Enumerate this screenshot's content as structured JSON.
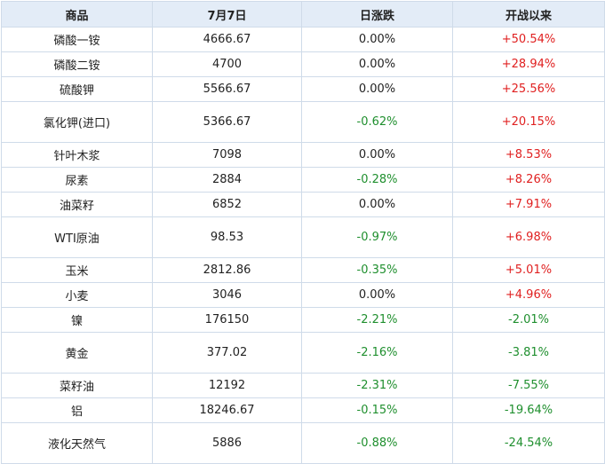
{
  "headers": [
    "商品",
    "7月7日",
    "日涨跌",
    "开战以来"
  ],
  "rows": [
    {
      "name": "磷酸一铵",
      "price": "4666.67",
      "daily": "0.00%",
      "since": "+50.54%"
    },
    {
      "name": "磷酸二铵",
      "price": "4700",
      "daily": "0.00%",
      "since": "+28.94%"
    },
    {
      "name": "硫酸钾",
      "price": "5566.67",
      "daily": "0.00%",
      "since": "+25.56%"
    },
    {
      "name": "氯化钾(进口)",
      "price": "5366.67",
      "daily": "-0.62%",
      "since": "+20.15%"
    },
    {
      "name": "针叶木浆",
      "price": "7098",
      "daily": "0.00%",
      "since": "+8.53%"
    },
    {
      "name": "尿素",
      "price": "2884",
      "daily": "-0.28%",
      "since": "+8.26%"
    },
    {
      "name": "油菜籽",
      "price": "6852",
      "daily": "0.00%",
      "since": "+7.91%"
    },
    {
      "name": "WTI原油",
      "price": "98.53",
      "daily": "-0.97%",
      "since": "+6.98%"
    },
    {
      "name": "玉米",
      "price": "2812.86",
      "daily": "-0.35%",
      "since": "+5.01%"
    },
    {
      "name": "小麦",
      "price": "3046",
      "daily": "0.00%",
      "since": "+4.96%"
    },
    {
      "name": "镍",
      "price": "176150",
      "daily": "-2.21%",
      "since": "-2.01%"
    },
    {
      "name": "黄金",
      "price": "377.02",
      "daily": "-2.16%",
      "since": "-3.81%"
    },
    {
      "name": "菜籽油",
      "price": "12192",
      "daily": "-2.31%",
      "since": "-7.55%"
    },
    {
      "name": "铝",
      "price": "18246.67",
      "daily": "-0.15%",
      "since": "-19.64%"
    },
    {
      "name": "液化天然气",
      "price": "5886",
      "daily": "-0.88%",
      "since": "-24.54%"
    }
  ],
  "colors": {
    "positive": "#e02020",
    "negative": "#1f8f2e",
    "header_bg": "#e3ecf7",
    "border": "#cfdbe9"
  }
}
